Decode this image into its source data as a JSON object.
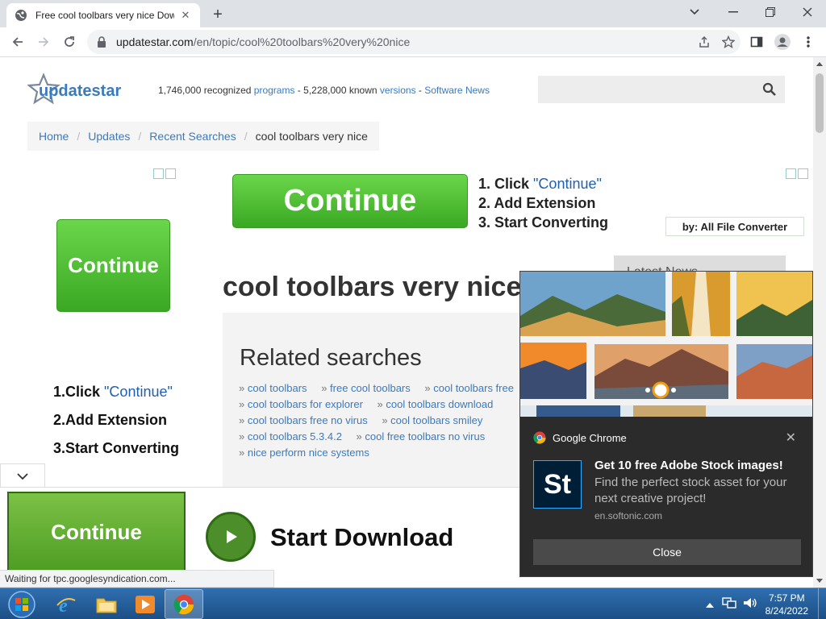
{
  "browser": {
    "tab_title": "Free cool toolbars very nice Dow",
    "url_host": "updatestar.com",
    "url_path": "/en/topic/cool%20toolbars%20very%20nice"
  },
  "header": {
    "logo_text": "updatestar",
    "stats": {
      "programs_count": "1,746,000 recognized",
      "programs_link": "programs",
      "sep1": " - ",
      "versions_count": "5,228,000 known",
      "versions_link": "versions",
      "sep2": " - ",
      "news_link": "Software News"
    }
  },
  "breadcrumb": [
    "Home",
    "Updates",
    "Recent Searches",
    "cool toolbars very nice"
  ],
  "ads": {
    "top_button": "Continue",
    "top_steps": [
      {
        "prefix": "1. Click ",
        "hl": "\"Continue\""
      },
      {
        "prefix": "2. Add Extension",
        "hl": ""
      },
      {
        "prefix": "3. Start Converting",
        "hl": ""
      }
    ],
    "top_by": "by: All File Converter",
    "side_button": "Continue",
    "side_steps": [
      {
        "prefix": "1.Click ",
        "hl": "\"Continue\""
      },
      {
        "prefix": "2.Add Extension",
        "hl": ""
      },
      {
        "prefix": "3.Start Converting",
        "hl": ""
      }
    ],
    "bottom_button": "Continue",
    "bottom_text": "Start Download"
  },
  "latest_news": "Latest News",
  "main": {
    "heading": "cool toolbars very nice",
    "related_title": "Related searches",
    "related_rows": [
      [
        "cool toolbars",
        "free cool toolbars",
        "cool toolbars free"
      ],
      [
        "cool toolbars for explorer",
        "cool toolbars download"
      ],
      [
        "cool toolbars free no virus",
        "cool toolbars smiley"
      ],
      [
        "cool toolbars 5.3.4.2",
        "cool free toolbars no virus"
      ],
      [
        "nice perform nice systems"
      ]
    ]
  },
  "status_text": "Waiting for tpc.googlesyndication.com...",
  "notification": {
    "app_name": "Google Chrome",
    "icon_text": "St",
    "title": "Get 10 free Adobe Stock images!",
    "body": "Find the perfect stock asset for your next creative project!",
    "source": "en.softonic.com",
    "close_label": "Close"
  },
  "taskbar": {
    "time": "7:57 PM",
    "date": "8/24/2022"
  },
  "colors": {
    "link": "#3a7abf",
    "accent_green": "#3aa823",
    "taskbar": "#1c4f86"
  }
}
